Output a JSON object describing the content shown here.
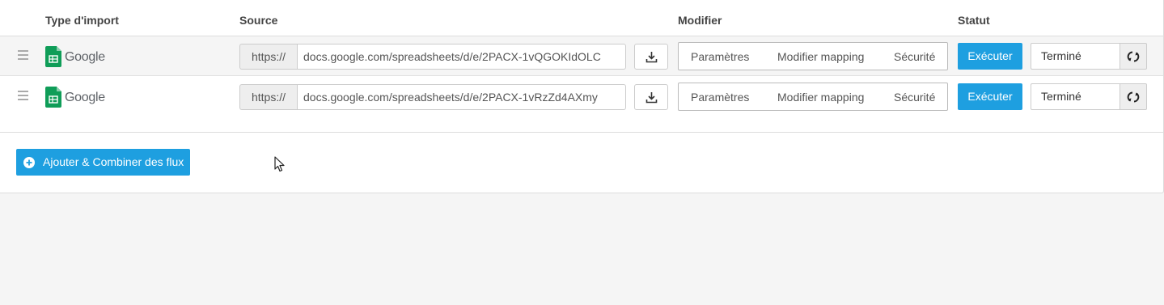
{
  "table": {
    "headers": {
      "type": "Type d'import",
      "source": "Source",
      "modifier": "Modifier",
      "statut": "Statut"
    },
    "rows": [
      {
        "provider": "Google",
        "url_prefix": "https://",
        "url": "docs.google.com/spreadsheets/d/e/2PACX-1vQGOKIdOLC",
        "actions": [
          "Paramètres",
          "Modifier mapping",
          "Sécurité"
        ],
        "run_label": "Exécuter",
        "status": "Terminé"
      },
      {
        "provider": "Google",
        "url_prefix": "https://",
        "url": "docs.google.com/spreadsheets/d/e/2PACX-1vRzZd4AXmy",
        "actions": [
          "Paramètres",
          "Modifier mapping",
          "Sécurité"
        ],
        "run_label": "Exécuter",
        "status": "Terminé"
      }
    ]
  },
  "add_button": {
    "label": "Ajouter & Combiner des flux"
  },
  "icons": {
    "drag": "drag-handle-icon",
    "provider": "google-sheets-icon",
    "download": "download-icon",
    "refresh": "refresh-icon",
    "add": "plus-circle-icon"
  },
  "colors": {
    "accent": "#1e9fe0",
    "sheets_green": "#0f9d58",
    "row_alt_bg": "#f5f5f5"
  }
}
